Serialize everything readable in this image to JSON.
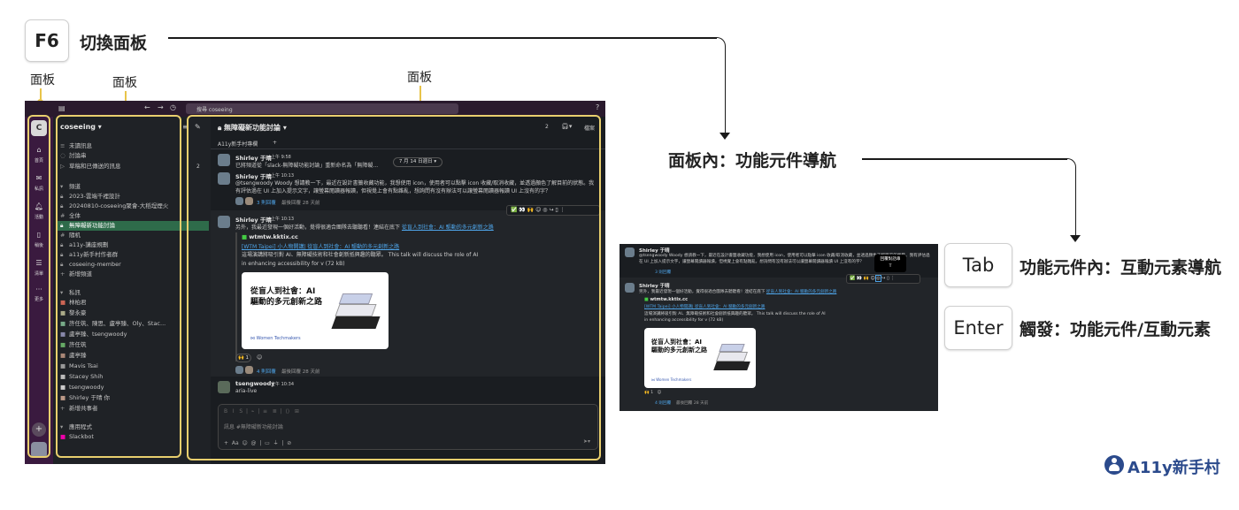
{
  "keys": {
    "f6": "F6",
    "tab": "Tab",
    "enter": "Enter"
  },
  "labels": {
    "switch_panel": "切換面板",
    "panel_nav": "面板內：功能元件導航",
    "component_nav": "功能元件內：互動元素導航",
    "trigger": "觸發：功能元件/互動元素",
    "panel_left": "面板",
    "panel_mid": "面板",
    "panel_main": "面板"
  },
  "brand": {
    "name": "A11y新手村"
  },
  "colors": {
    "highlight": "#e9cf6e",
    "brand": "#2b4a8c",
    "active_channel": "#2e6b4a",
    "link": "#4ea3e6"
  },
  "slack": {
    "search_placeholder": "搜尋 coseeing",
    "workspace": "coseeing",
    "workspace_initial": "C",
    "rail": [
      "首頁",
      "私訊",
      "活動",
      "稍後",
      "清單",
      "更多"
    ],
    "sidebar_top": [
      "未讀訊息",
      "討論串",
      "草稿和已傳送的訊息"
    ],
    "draft_count": "2",
    "channels_header": "頻道",
    "channels": [
      "2023-雲端千裡設計",
      "20240810-coseeing聚會-大稻埕煙火",
      "全体",
      "無障礙新功能討論",
      "隨机",
      "a11y-講座規劃",
      "a11y新手村作者群",
      "coseeing-member",
      "新增頻道"
    ],
    "dm_header": "私訊",
    "dms": [
      "林柏君",
      "黎永豪",
      "許任筑、陳思、盧亭臻、Oly、Stac...",
      "盧亭臻、tsengwoody",
      "許任筑",
      "盧亭臻",
      "Mavis Tsai",
      "Stacey Shih",
      "tsengwoody",
      "Shirley 于晴  你",
      "新增共事者"
    ],
    "apps_header": "應用程式",
    "apps": [
      "Slackbot"
    ],
    "channel_title": "無障礙新功能討論",
    "member_count": "2",
    "huddle": "檔案",
    "bookmark": "A11y新手村專欄",
    "date_pill": "7 月 14 日週日",
    "messages": [
      {
        "author": "Shirley 于晴",
        "time": "上午 9:58",
        "text": "已將頻道從「slack-無障礙功能討論」重新命名為「無障礙..."
      },
      {
        "author": "Shirley 于晴",
        "time": "上午 10:13",
        "text": "@tsengwoody Woody 想請教一下，最近在設計書籤收藏功能，我想使用 icon，使用者可以點擊 icon 收藏/取消收藏，並透過顏色了解目前的狀態。我有評估過在 UI 上加入提示文字，讓螢幕閱讀器報讀，但視覺上會有點雜亂，想詢問有沒有辦法可以讓螢幕閱讀器報讀 UI 上沒有的字？",
        "replies": "3 則回覆",
        "last": "最後回覆 28 天前"
      },
      {
        "author": "Shirley 于晴",
        "time": "上午 10:13",
        "text": "另外，我最近發現一個好活動，覺得很適合團隊去聽聽看！連結在底下",
        "link": "從盲人到社會：AI 驅動的多元創新之路",
        "site": "wtmtw.kktix.cc",
        "title": "[WTM Taipei] 小人物開講| 從盲人到社會：AI 驅動的多元創新之路",
        "desc": "這場演講將吸引對 AI、無障礙技術和社會創新抵興趣的聽眾。 This talk will discuss the role of AI in enhancing accessibility for v (72 kB)",
        "card_title": "從盲人到社會：AI 驅動的多元創新之路",
        "card_org": "Women Techmakers",
        "reaction": "1",
        "replies": "4 則回覆",
        "last": "最後回覆 28 天前"
      },
      {
        "author": "tsengwoody",
        "time": "上午 10:34",
        "text": "aria-live"
      }
    ],
    "composer_placeholder": "訊息 #無障礙新功能討論",
    "tooltip": "回覆對話串"
  }
}
